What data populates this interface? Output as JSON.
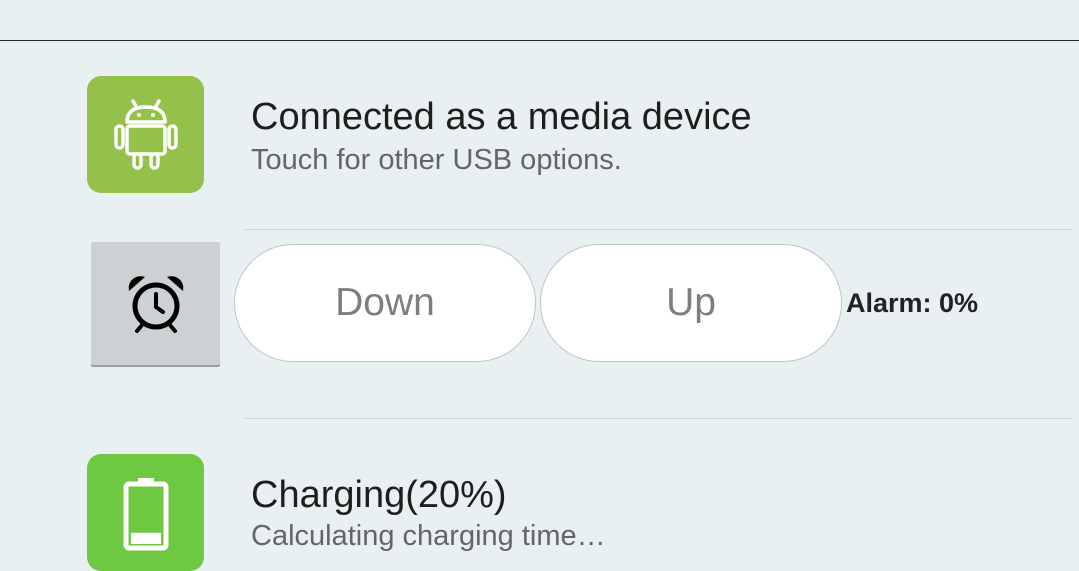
{
  "usb_notification": {
    "icon": "android-icon",
    "title": "Connected as a media device",
    "subtitle": "Touch for other USB options."
  },
  "alarm_control": {
    "icon": "alarm-clock-icon",
    "down_label": "Down",
    "up_label": "Up",
    "level_text": "Alarm: 0%"
  },
  "battery_notification": {
    "icon": "battery-icon",
    "title": "Charging(20%)",
    "subtitle": "Calculating charging time…",
    "charge_level": 0.2
  },
  "colors": {
    "usb_tile": "#94c14a",
    "battery_tile": "#6ec842",
    "panel_bg": "#e9f0f2"
  }
}
